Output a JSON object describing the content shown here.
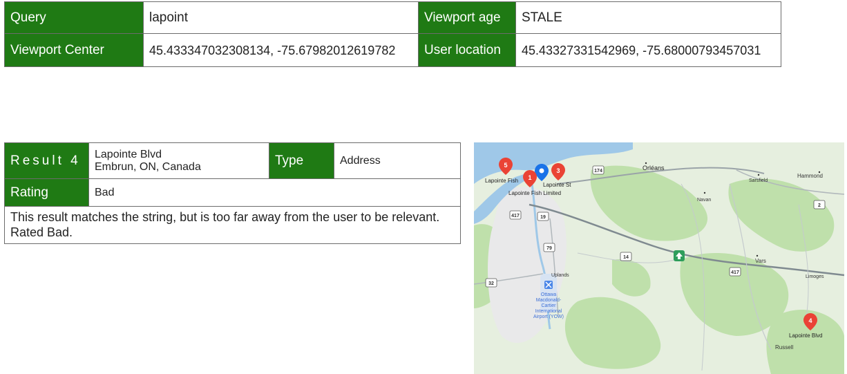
{
  "query_info": {
    "query_label": "Query",
    "query_value": "lapoint",
    "viewport_age_label": "Viewport age",
    "viewport_age_value": "STALE",
    "viewport_center_label": "Viewport Center",
    "viewport_center_value": "45.433347032308134, -75.67982012619782",
    "user_location_label": "User location",
    "user_location_value": "45.43327331542969, -75.68000793457031"
  },
  "result": {
    "result_label": "Result 4",
    "address_line1": "Lapointe Blvd",
    "address_line2": "Embrun, ON, Canada",
    "type_label": "Type",
    "type_value": "Address",
    "rating_label": "Rating",
    "rating_value": "Bad",
    "description": "This result matches the string, but is too far away from the user to be relevant. Rated Bad."
  },
  "map": {
    "places": {
      "orleans": "Orléans",
      "hammond": "Hammond",
      "sarsfield": "Sarsfield",
      "navan": "Navan",
      "vars": "Vars",
      "limoges": "Limoges",
      "russell": "Russell",
      "uplands": "Uplands",
      "lapointe_fish": "Lapointe Fish",
      "lapointe_st": "Lapointe St",
      "lapointe_fish_limited": "Lapointe Fish Limited",
      "lapointe_blvd": "Lapointe Blvd",
      "airport_line1": "Ottawa",
      "airport_line2": "Macdonald-",
      "airport_line3": "Cartier",
      "airport_line4": "International",
      "airport_line5": "Airport (YOW)"
    },
    "shields": [
      "174",
      "417",
      "19",
      "79",
      "14",
      "417",
      "2",
      "32"
    ],
    "pins": [
      "1",
      "3",
      "4",
      "5"
    ],
    "colors": {
      "pin": "#ea4335",
      "user": "#1a73e8",
      "water": "#9fc8e8",
      "land": "#e3eedc",
      "green": "#b7dba3"
    }
  }
}
